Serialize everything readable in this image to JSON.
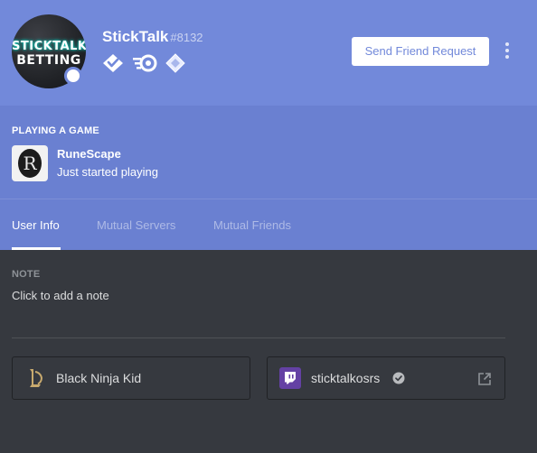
{
  "user": {
    "avatar_text_line1": "STICKTALK",
    "avatar_text_line2": "BETTING",
    "username": "StickTalk",
    "discriminator": "#8132",
    "status": "online",
    "badges": [
      "hypesquad-icon",
      "nitro-icon",
      "nitro-boost-icon"
    ]
  },
  "actions": {
    "friend_request_label": "Send Friend Request"
  },
  "activity": {
    "header": "PLAYING A GAME",
    "game_name": "RuneScape",
    "game_state": "Just started playing",
    "game_icon_letter": "R"
  },
  "tabs": [
    {
      "label": "User Info",
      "active": true
    },
    {
      "label": "Mutual Servers",
      "active": false
    },
    {
      "label": "Mutual Friends",
      "active": false
    }
  ],
  "note": {
    "label": "NOTE",
    "placeholder": "Click to add a note"
  },
  "connections": [
    {
      "service": "league-of-legends-icon",
      "name": "Black Ninja Kid",
      "verified": false
    },
    {
      "service": "twitch-icon",
      "name": "sticktalkosrs",
      "verified": true
    }
  ],
  "colors": {
    "blurple": "#7289da",
    "twitch": "#6441a4",
    "league": "#c8aa6e",
    "background": "#36393f"
  }
}
